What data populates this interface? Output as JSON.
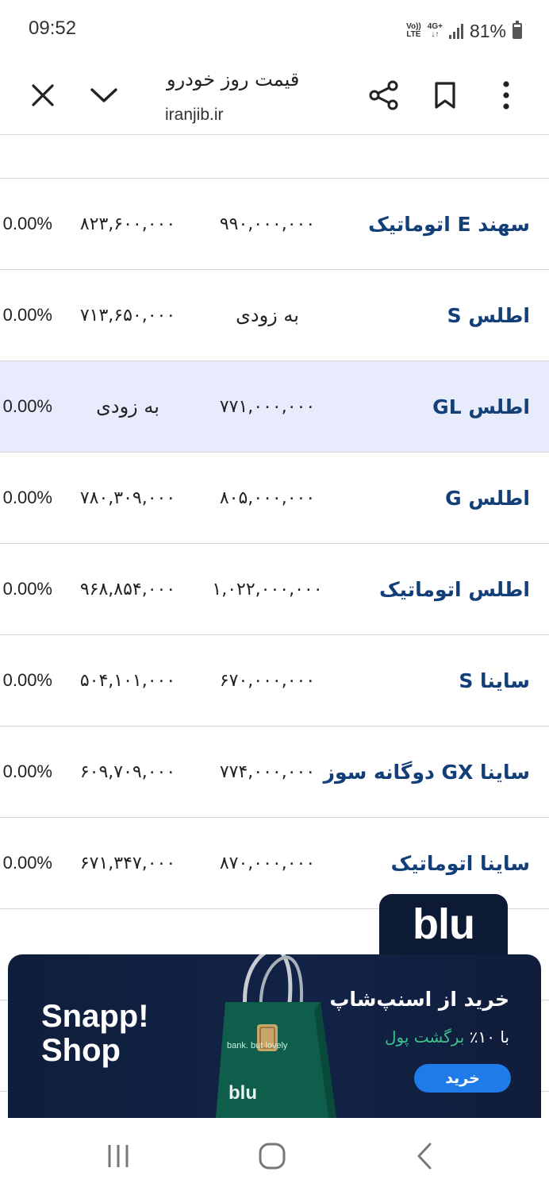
{
  "status_bar": {
    "time": "09:52",
    "network_top": "Vo))",
    "network_bottom": "LTE",
    "network_type": "4G+",
    "battery": "81%"
  },
  "browser": {
    "title": "قیمت روز خودرو",
    "url": "iranjib.ir",
    "icons": [
      "close-icon",
      "chevron-down-icon",
      "share-icon",
      "bookmark-icon",
      "more-vert-icon"
    ]
  },
  "table": {
    "rows": [
      {
        "name": "سهند E اتوماتیک",
        "price1": "۹۹۰,۰۰۰,۰۰۰",
        "price2": "۸۲۳,۶۰۰,۰۰۰",
        "change": "0.00%"
      },
      {
        "name": "اطلس S",
        "price1": "به زودی",
        "price2": "۷۱۳,۶۵۰,۰۰۰",
        "change": "0.00%"
      },
      {
        "name": "اطلس GL",
        "price1": "۷۷۱,۰۰۰,۰۰۰",
        "price2": "به زودی",
        "change": "0.00%"
      },
      {
        "name": "اطلس G",
        "price1": "۸۰۵,۰۰۰,۰۰۰",
        "price2": "۷۸۰,۳۰۹,۰۰۰",
        "change": "0.00%"
      },
      {
        "name": "اطلس اتوماتیک",
        "price1": "۱,۰۲۲,۰۰۰,۰۰۰",
        "price2": "۹۶۸,۸۵۴,۰۰۰",
        "change": "0.00%"
      },
      {
        "name": "ساینا S",
        "price1": "۶۷۰,۰۰۰,۰۰۰",
        "price2": "۵۰۴,۱۰۱,۰۰۰",
        "change": "0.00%"
      },
      {
        "name": "ساینا GX دوگانه سوز",
        "price1": "۷۷۴,۰۰۰,۰۰۰",
        "price2": "۶۰۹,۷۰۹,۰۰۰",
        "change": "0.00%"
      },
      {
        "name": "ساینا اتوماتیک",
        "price1": "۸۷۰,۰۰۰,۰۰۰",
        "price2": "۶۷۱,۳۴۷,۰۰۰",
        "change": "0.00%"
      }
    ]
  },
  "ad": {
    "tab_logo": "blu",
    "brand_line1": "Snapp!",
    "brand_line2": "Shop",
    "bag_text": "bank. but lovely",
    "bag_logo": "blu",
    "title": "خرید از اسنپ‌شاپ",
    "subtitle_prefix": "با ۱۰٪",
    "subtitle_highlight": "برگشت پول",
    "button": "خرید",
    "colors": {
      "background": "#0f1e3a",
      "bag": "#0e5e4b",
      "button": "#1e7be8",
      "highlight": "#3dbf8e"
    }
  },
  "nav_bar": {
    "icons": [
      "recents-icon",
      "home-icon",
      "back-icon"
    ]
  },
  "colors": {
    "name_text": "#123f78",
    "highlight_row": "#e8ebfb",
    "divider": "#d6d6d6"
  }
}
